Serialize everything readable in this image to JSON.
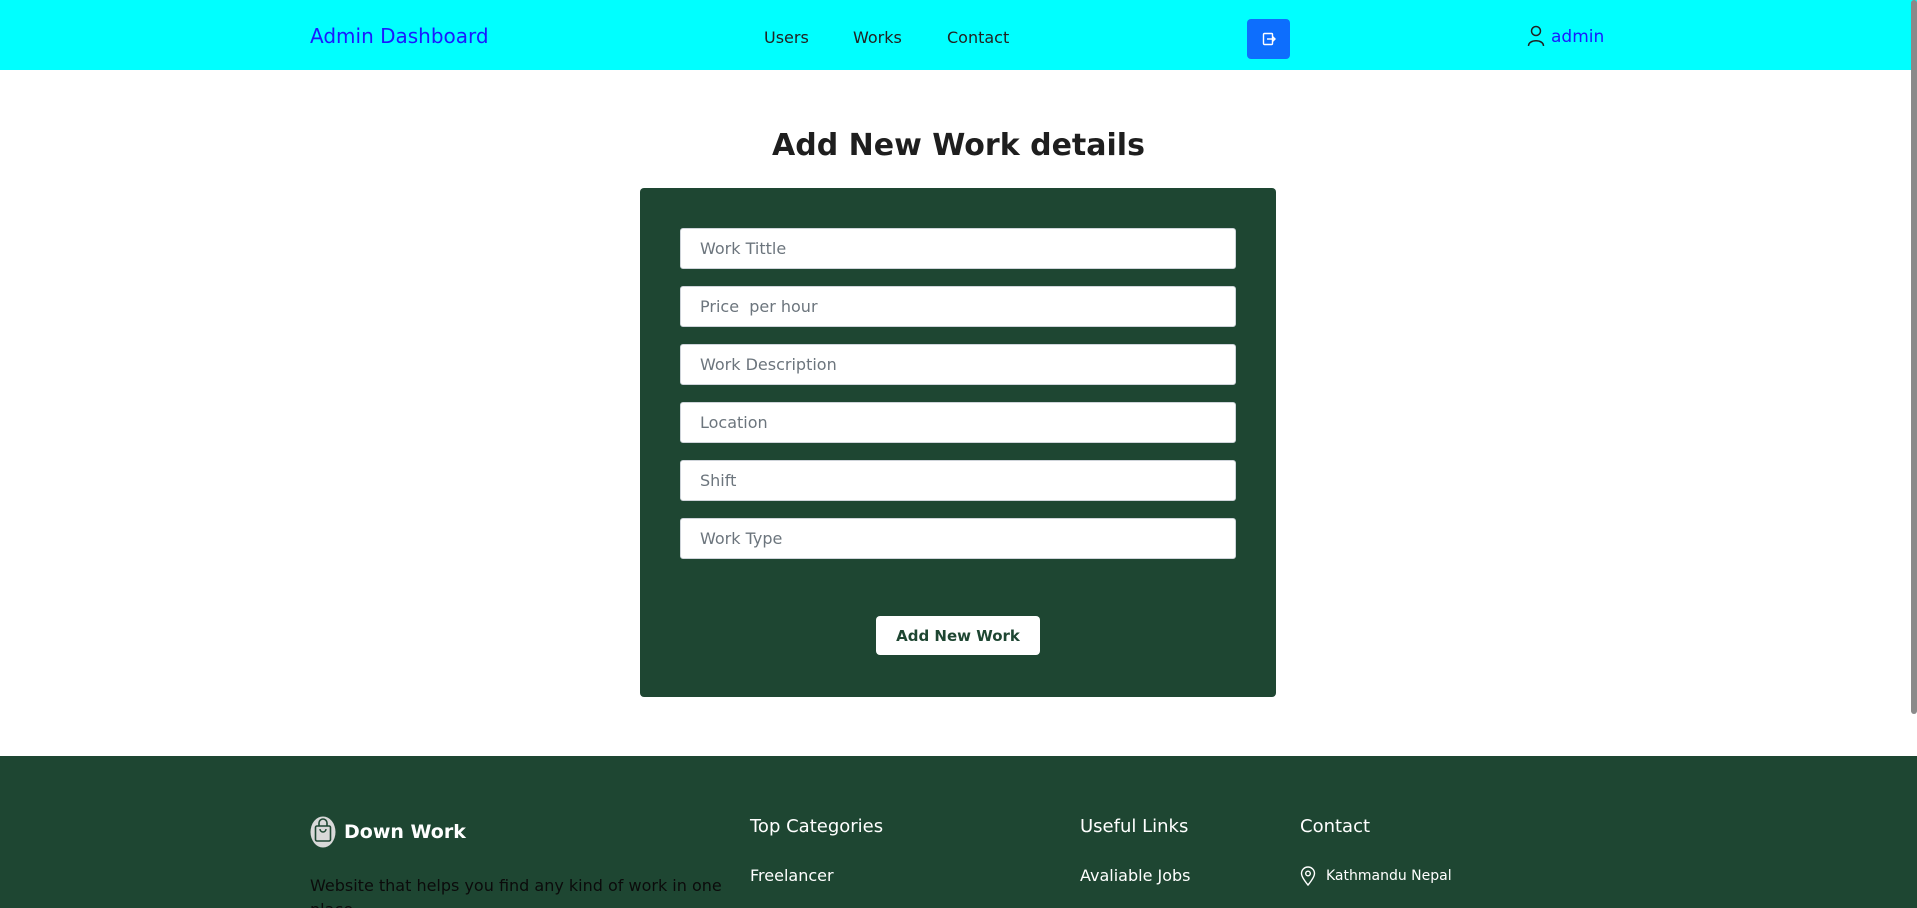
{
  "navbar": {
    "brand": "Admin Dashboard",
    "links": [
      "Users",
      "Works",
      "Contact"
    ],
    "logout_icon": "logout-icon",
    "user_icon": "user-icon",
    "username": "admin"
  },
  "main": {
    "title": "Add New Work details",
    "fields": [
      {
        "placeholder": "Work Tittle",
        "value": ""
      },
      {
        "placeholder": "Price  per hour",
        "value": ""
      },
      {
        "placeholder": "Work Description",
        "value": ""
      },
      {
        "placeholder": "Location",
        "value": ""
      },
      {
        "placeholder": "Shift",
        "value": ""
      },
      {
        "placeholder": "Work Type",
        "value": ""
      }
    ],
    "submit_label": "Add New Work"
  },
  "footer": {
    "brand": "Down Work",
    "brand_icon": "shopping-bag-icon",
    "description": "Website that helps you find any kind of work in one place",
    "top_categories": {
      "heading": "Top Categories",
      "links": [
        "Freelancer"
      ]
    },
    "useful_links": {
      "heading": "Useful Links",
      "links": [
        "Avaliable Jobs"
      ]
    },
    "contact": {
      "heading": "Contact",
      "location_icon": "map-pin-icon",
      "address": "Kathmandu Nepal"
    }
  },
  "colors": {
    "navbar_bg": "#00ffff",
    "brand_text": "#1a1aff",
    "panel_bg": "#1e4632",
    "logout_btn": "#0d6efd"
  }
}
